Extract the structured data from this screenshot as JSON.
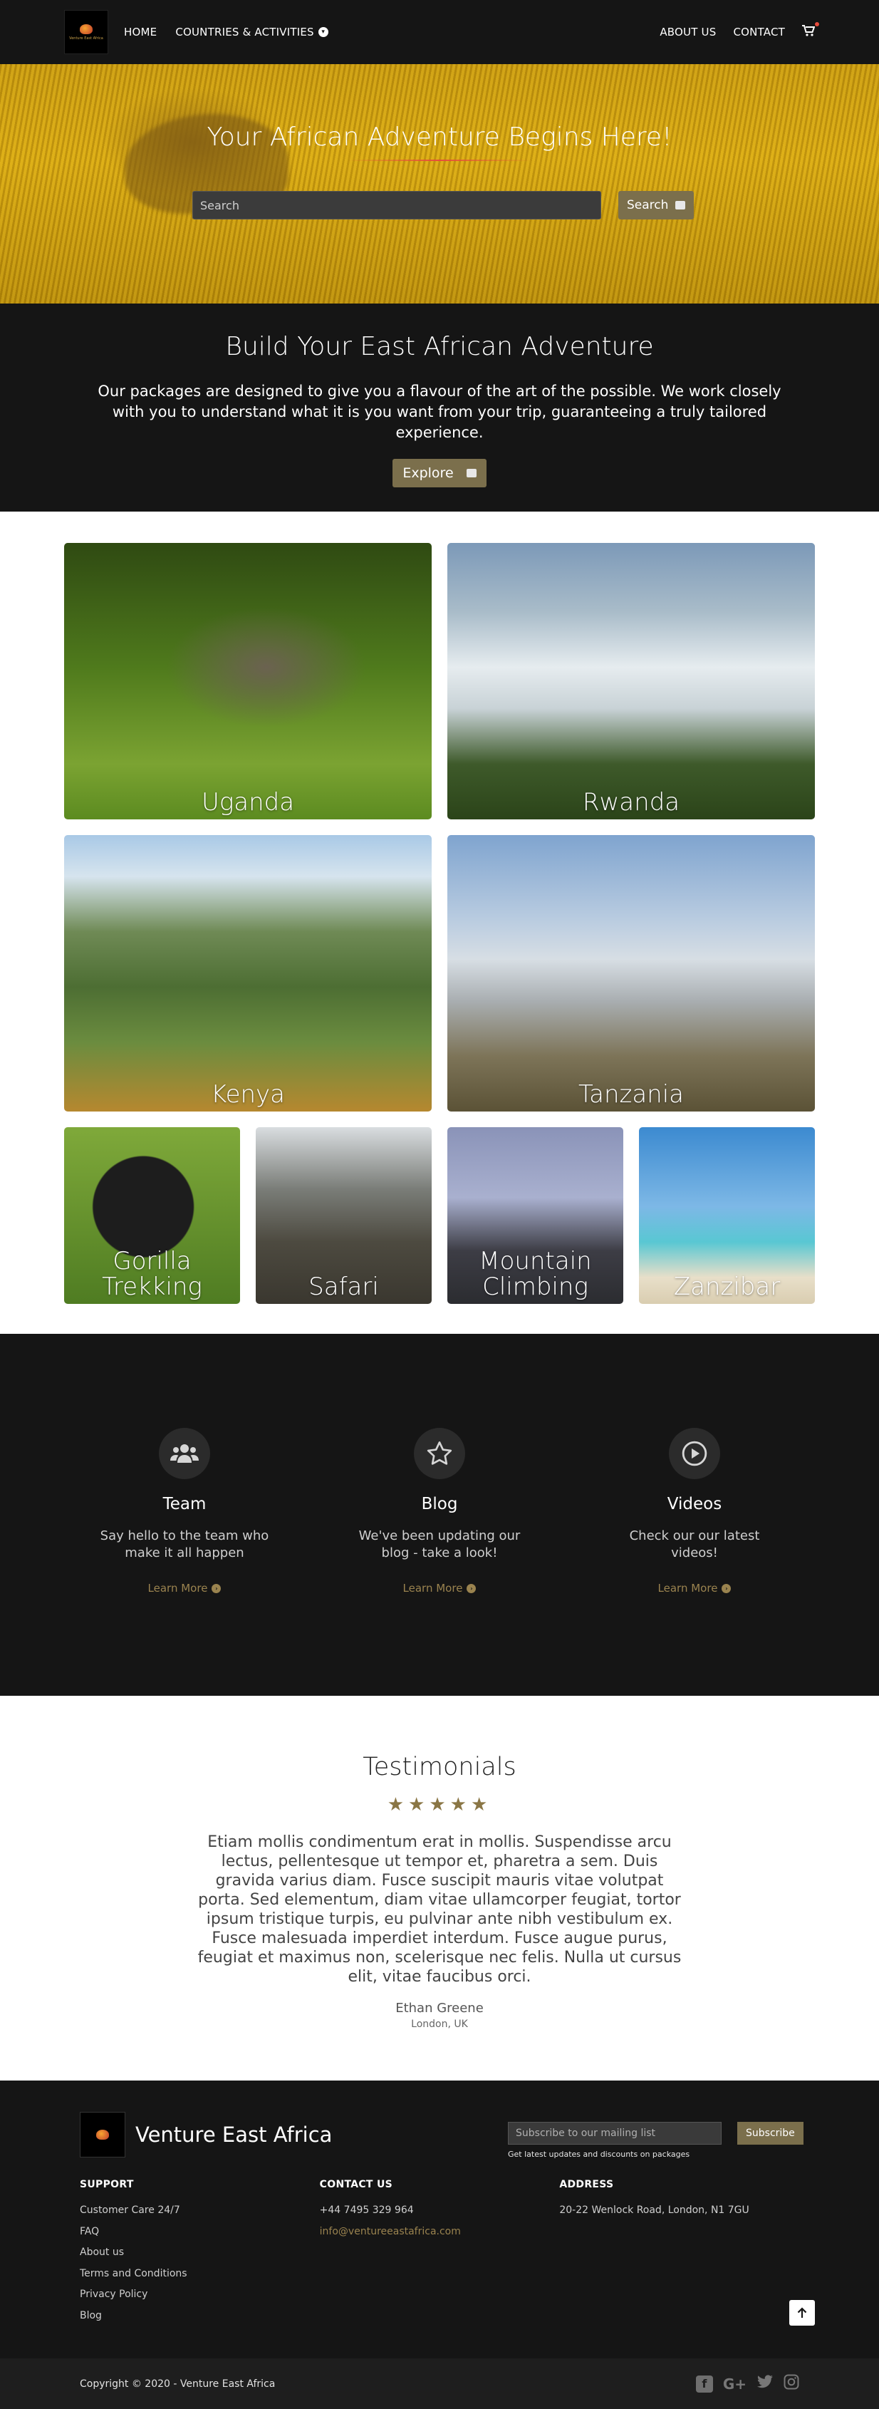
{
  "nav": {
    "logo_text": "Venture East Africa",
    "home": "HOME",
    "countries": "COUNTRIES & ACTIVITIES",
    "about": "ABOUT US",
    "contact": "CONTACT",
    "cart_icon": "cart-icon"
  },
  "hero": {
    "title": "Your African Adventure Begins Here!",
    "search_placeholder": "Search",
    "search_button": "Search"
  },
  "build": {
    "title": "Build Your East African Adventure",
    "text": "Our packages are designed to give you a flavour of the art of the possible. We work closely with you to understand what it is you want from your trip, guaranteeing a truly tailored experience.",
    "button": "Explore"
  },
  "destinations": {
    "countries": [
      "Uganda",
      "Rwanda",
      "Kenya",
      "Tanzania"
    ],
    "activities": [
      "Gorilla Trekking",
      "Safari",
      "Mountain Climbing",
      "Zanzibar"
    ]
  },
  "features": [
    {
      "icon": "users-icon",
      "title": "Team",
      "text": "Say hello to the team who make it all happen",
      "link": "Learn More"
    },
    {
      "icon": "star-icon",
      "title": "Blog",
      "text": "We've been updating our blog - take a look!",
      "link": "Learn More"
    },
    {
      "icon": "play-icon",
      "title": "Videos",
      "text": "Check our our latest videos!",
      "link": "Learn More"
    }
  ],
  "testimonials": {
    "title": "Testimonials",
    "stars": "★★★★★",
    "rating": 5,
    "quote": "Etiam mollis condimentum erat in mollis. Suspendisse arcu lectus, pellentesque ut tempor et, pharetra a sem. Duis gravida varius diam. Fusce suscipit mauris vitae volutpat porta. Sed elementum, diam vitae ullamcorper feugiat, tortor ipsum tristique turpis, eu pulvinar ante nibh vestibulum ex. Fusce malesuada imperdiet interdum. Fusce augue purus, feugiat et maximus non, scelerisque nec felis. Nulla ut cursus elit, vitae faucibus orci.",
    "author": "Ethan Greene",
    "location": "London, UK"
  },
  "footer": {
    "brand": "Venture East Africa",
    "subscribe_placeholder": "Subscribe to our mailing list",
    "subscribe_button": "Subscribe",
    "subscribe_note": "Get latest updates and discounts on packages",
    "support": {
      "title": "SUPPORT",
      "items": [
        "Customer Care 24/7",
        "FAQ",
        "About us",
        "Terms and Conditions",
        "Privacy Policy",
        "Blog"
      ]
    },
    "contact": {
      "title": "CONTACT US",
      "phone": "+44 7495 329 964",
      "email": "info@ventureeastafrica.com"
    },
    "address": {
      "title": "ADDRESS",
      "line": "20-22 Wenlock Road, London, N1 7GU"
    },
    "copyright": "Copyright © 2020 - Venture East Africa",
    "social": [
      "facebook-icon",
      "google-plus-icon",
      "twitter-icon",
      "instagram-icon"
    ]
  },
  "colors": {
    "dark": "#151515",
    "accent": "#7b6f4c",
    "gold_link": "#9a834f"
  }
}
